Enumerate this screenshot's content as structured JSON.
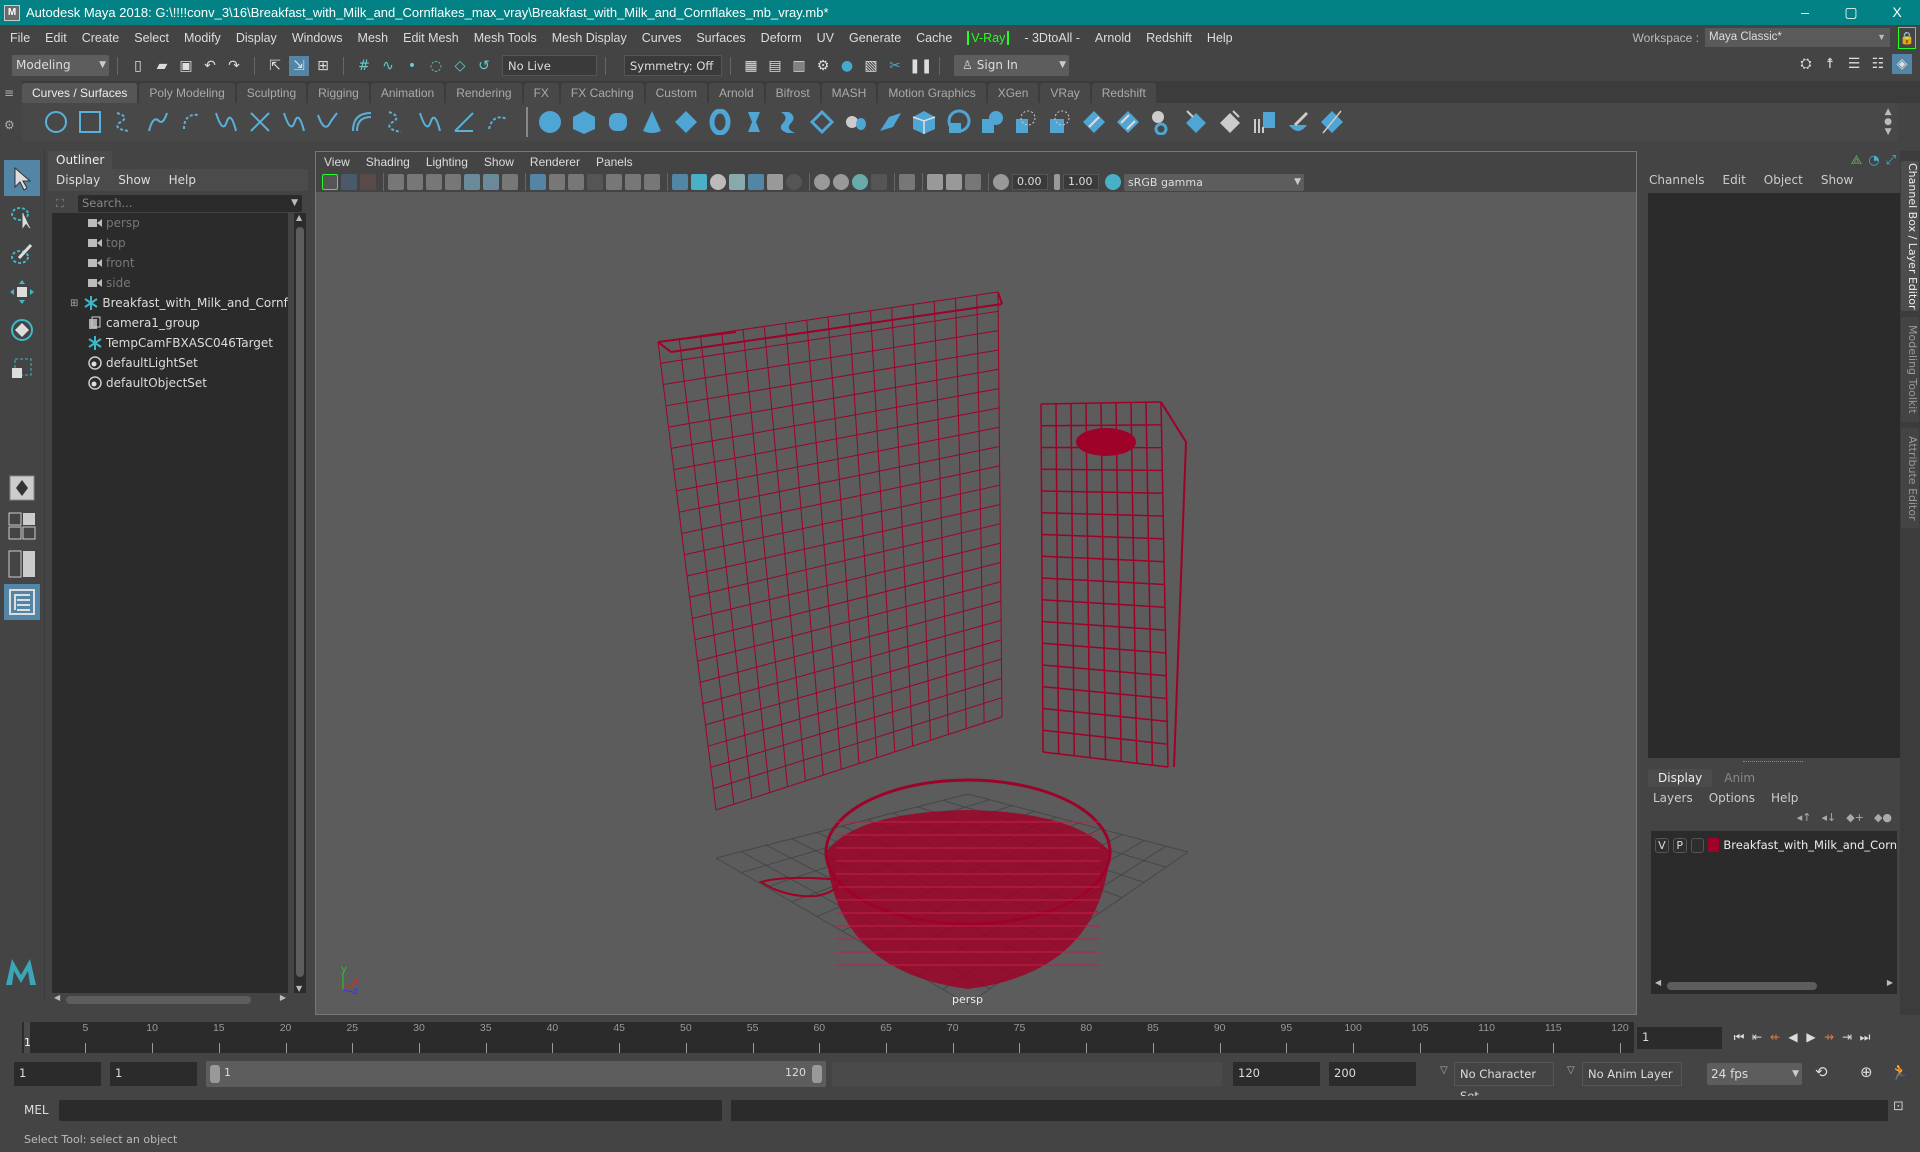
{
  "window": {
    "title": "Autodesk Maya 2018: G:\\!!!!conv_3\\16\\Breakfast_with_Milk_and_Cornflakes_max_vray\\Breakfast_with_Milk_and_Cornflakes_mb_vray.mb*",
    "logo_letter": "M",
    "minimize": "–",
    "maximize": "▢",
    "close": "X"
  },
  "menubar": {
    "items": [
      "File",
      "Edit",
      "Create",
      "Select",
      "Modify",
      "Display",
      "Windows",
      "Mesh",
      "Edit Mesh",
      "Mesh Tools",
      "Mesh Display",
      "Curves",
      "Surfaces",
      "Deform",
      "UV",
      "Generate",
      "Cache",
      "V-Ray",
      "- 3DtoAll -",
      "Arnold",
      "Redshift",
      "Help"
    ],
    "workspace_label": "Workspace :",
    "workspace_value": "Maya Classic*"
  },
  "statusline": {
    "mode": "Modeling",
    "live_surface": "No Live Surface",
    "symmetry": "Symmetry: Off",
    "sign_in": "Sign In"
  },
  "shelf": {
    "tabs": [
      "Curves / Surfaces",
      "Poly Modeling",
      "Sculpting",
      "Rigging",
      "Animation",
      "Rendering",
      "FX",
      "FX Caching",
      "Custom",
      "Arnold",
      "Bifrost",
      "MASH",
      "Motion Graphics",
      "XGen",
      "VRay",
      "Redshift"
    ],
    "active_tab": "Curves / Surfaces"
  },
  "outliner": {
    "title": "Outliner",
    "menu": [
      "Display",
      "Show",
      "Help"
    ],
    "search_placeholder": "Search...",
    "items": [
      {
        "label": "persp",
        "icon": "camera-icon",
        "dim": true
      },
      {
        "label": "top",
        "icon": "camera-icon",
        "dim": true
      },
      {
        "label": "front",
        "icon": "camera-icon",
        "dim": true
      },
      {
        "label": "side",
        "icon": "camera-icon",
        "dim": true
      },
      {
        "label": "Breakfast_with_Milk_and_Cornflakes_",
        "icon": "transform-icon",
        "expandable": true
      },
      {
        "label": "camera1_group",
        "icon": "group-icon"
      },
      {
        "label": "TempCamFBXASC046Target",
        "icon": "transform-icon"
      },
      {
        "label": "defaultLightSet",
        "icon": "set-icon"
      },
      {
        "label": "defaultObjectSet",
        "icon": "set-icon"
      }
    ]
  },
  "viewport": {
    "menu": [
      "View",
      "Shading",
      "Lighting",
      "Show",
      "Renderer",
      "Panels"
    ],
    "exposure": "0.00",
    "gamma": "1.00",
    "color_space": "sRGB gamma",
    "camera_label": "persp",
    "wire_color": "#9e0228",
    "axis": {
      "x": "x",
      "y": "y",
      "z": "z"
    }
  },
  "channelbox": {
    "menu": [
      "Channels",
      "Edit",
      "Object",
      "Show"
    ],
    "side_tabs": [
      "Channel Box / Layer Editor",
      "Modeling Toolkit",
      "Attribute Editor"
    ]
  },
  "layers": {
    "tabs": [
      "Display",
      "Anim"
    ],
    "menu": [
      "Layers",
      "Options",
      "Help"
    ],
    "rows": [
      {
        "v": "V",
        "p": "P",
        "color": "#9e0228",
        "name": "Breakfast_with_Milk_and_Corn"
      }
    ]
  },
  "timeline": {
    "ticks": [
      5,
      10,
      15,
      20,
      25,
      30,
      35,
      40,
      45,
      50,
      55,
      60,
      65,
      70,
      75,
      80,
      85,
      90,
      95,
      100,
      105,
      110,
      115,
      120
    ],
    "start": 1,
    "end": 120,
    "current_frame_label": "1",
    "current_frame_field": "1"
  },
  "range": {
    "start_field": "1",
    "playback_start": "1",
    "slider_start": "1",
    "slider_end": "120",
    "playback_end": "120",
    "end_field": "200",
    "character_set": "No Character Set",
    "anim_layer": "No Anim Layer",
    "fps": "24 fps"
  },
  "commandline": {
    "label": "MEL"
  },
  "helpline": {
    "text": "Select Tool: select an object"
  }
}
